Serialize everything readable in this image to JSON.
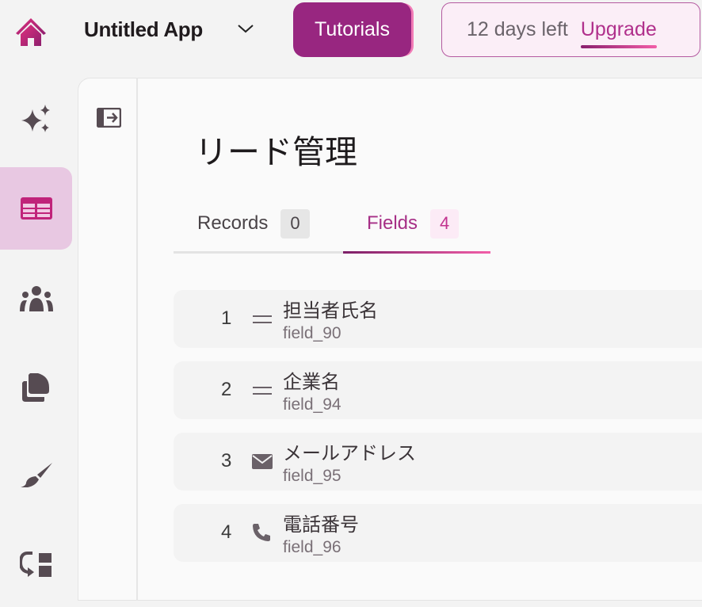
{
  "header": {
    "app_name": "Untitled App",
    "tutorials": "Tutorials",
    "trial": "12 days left",
    "upgrade": "Upgrade"
  },
  "page": {
    "title": "リード管理"
  },
  "tabs": [
    {
      "label": "Records",
      "count": "0"
    },
    {
      "label": "Fields",
      "count": "4"
    }
  ],
  "fields": [
    {
      "index": "1",
      "label": "担当者氏名",
      "key": "field_90",
      "icon": "text-icon"
    },
    {
      "index": "2",
      "label": "企業名",
      "key": "field_94",
      "icon": "text-icon"
    },
    {
      "index": "3",
      "label": "メールアドレス",
      "key": "field_95",
      "icon": "mail-icon"
    },
    {
      "index": "4",
      "label": "電話番号",
      "key": "field_96",
      "icon": "phone-icon"
    }
  ],
  "colors": {
    "accent": "#982680",
    "active_bg": "#e8c8e2",
    "icon": "#564b52"
  }
}
